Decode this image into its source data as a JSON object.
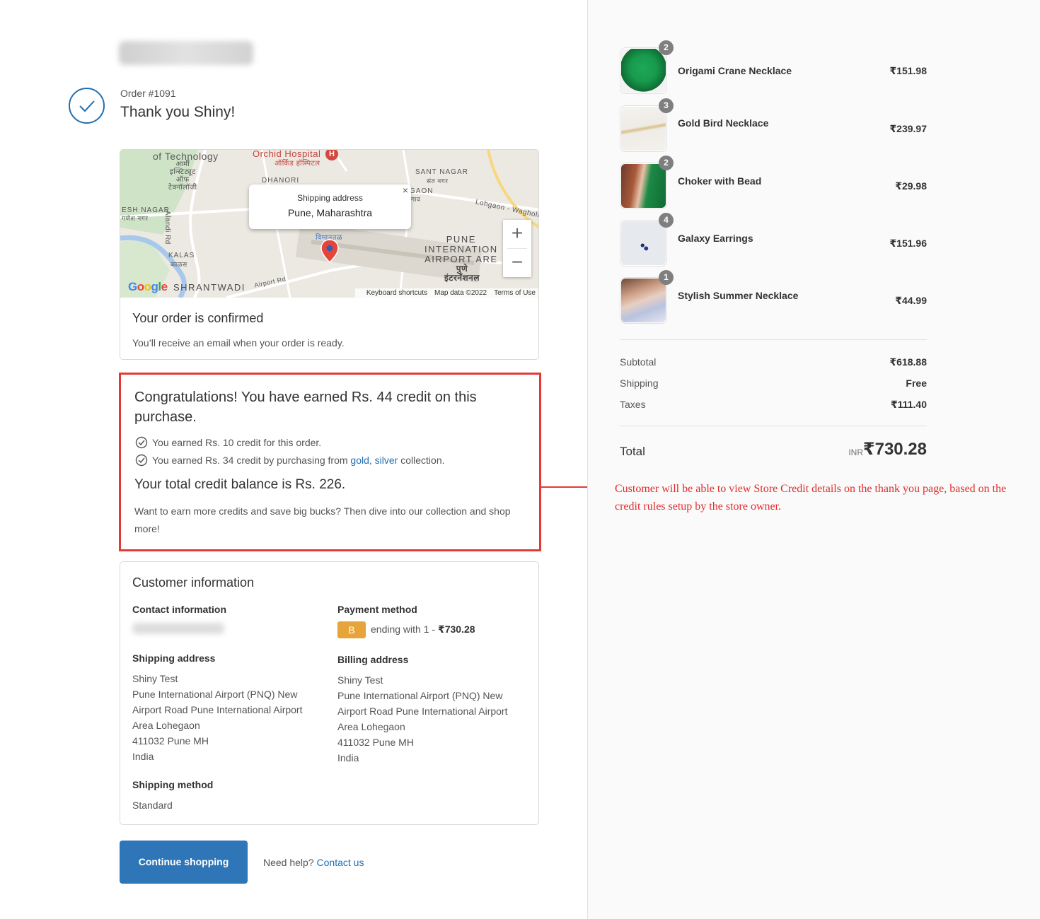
{
  "header": {
    "order_number": "Order #1091",
    "thank_you": "Thank you Shiny!"
  },
  "map": {
    "labels": {
      "of_technology": "of Technology",
      "orchid_hospital": "Orchid Hospital",
      "orchid_hospital_hindi": "ऑर्किड हॉस्पिटल",
      "army_institute": "आर्मी\nइन्स्टिट्यूट\nऑफ\nटेक्नॉलॉजी",
      "dhanori": "DHANORI",
      "sant_nagar": "SANT NAGAR",
      "sant_nagar_hindi": "संत नगर",
      "gaon": "GAON",
      "gaon_hindi": "गाव",
      "lohgaon_wagholi": "Lohgaon - Wagholi R",
      "esh_nagar": "ESH NAGAR",
      "esh_nagar_hindi": "गणेश नगर",
      "alandi_rd": "Alandi Rd",
      "viman_tal": "विमानतळ",
      "pune_airport": "PUNE\nINTERNATION\nAIRPORT ARE",
      "pune_airport_hindi": "पुणे\nइंटरनॅशनल",
      "kalas": "KALAS",
      "kalas_hindi": "काळस",
      "shrantwadi": "SHRANTWADI",
      "airport_rd": "Airport Rd"
    },
    "popup_title": "Shipping address",
    "popup_location": "Pune, Maharashtra",
    "popup_close": "×",
    "zoom_in": "+",
    "zoom_out": "−",
    "google_logo": "Google",
    "attribution": {
      "shortcuts": "Keyboard shortcuts",
      "map_data": "Map data ©2022",
      "terms": "Terms of Use"
    }
  },
  "confirmation": {
    "title": "Your order is confirmed",
    "message": "You’ll receive an email when your order is ready."
  },
  "credit": {
    "headline": "Congratulations! You have earned Rs. 44 credit on this purchase.",
    "line1": "You earned Rs. 10 credit for this order.",
    "line2_prefix": "You earned Rs. 34 credit by purchasing from ",
    "line2_link1": "gold",
    "line2_sep": ", ",
    "line2_link2": "silver",
    "line2_suffix": " collection.",
    "total_balance": "Your total credit balance is Rs. 226.",
    "encourage": "Want to earn more credits and save big bucks? Then dive into our collection and shop more!"
  },
  "customer": {
    "title": "Customer information",
    "contact_heading": "Contact information",
    "payment_heading": "Payment method",
    "payment_badge": "B",
    "payment_ending": "ending with 1 - ",
    "payment_amount": "₹730.28",
    "shipping_address_heading": "Shipping address",
    "shipping_address": "Shiny Test\nPune International Airport (PNQ) New\nAirport Road Pune International Airport\nArea Lohegaon\n411032 Pune MH\nIndia",
    "billing_address_heading": "Billing address",
    "billing_address": "Shiny Test\nPune International Airport (PNQ) New\nAirport Road Pune International Airport\nArea Lohegaon\n411032 Pune MH\nIndia",
    "shipping_method_heading": "Shipping method",
    "shipping_method": "Standard"
  },
  "footer": {
    "continue_label": "Continue shopping",
    "help_text": "Need help? ",
    "contact_link": "Contact us"
  },
  "order_items": [
    {
      "name": "Origami Crane Necklace",
      "qty": "2",
      "price": "₹151.98"
    },
    {
      "name": "Gold Bird Necklace",
      "qty": "3",
      "price": "₹239.97"
    },
    {
      "name": "Choker with Bead",
      "qty": "2",
      "price": "₹29.98"
    },
    {
      "name": "Galaxy Earrings",
      "qty": "4",
      "price": "₹151.96"
    },
    {
      "name": "Stylish Summer Necklace",
      "qty": "1",
      "price": "₹44.99"
    }
  ],
  "summary": {
    "subtotal_label": "Subtotal",
    "subtotal_value": "₹618.88",
    "shipping_label": "Shipping",
    "shipping_value": "Free",
    "taxes_label": "Taxes",
    "taxes_value": "₹111.40",
    "total_label": "Total",
    "currency": "INR",
    "total_value": "₹730.28"
  },
  "annotation": {
    "text": "Customer will be able to view Store Credit details on the thank you page, based on the credit rules setup by the store owner."
  },
  "colors": {
    "accent_blue": "#1f6fb2",
    "button_blue": "#2f76b9",
    "highlight_red": "#e53935",
    "payment_badge": "#e6a43a"
  }
}
